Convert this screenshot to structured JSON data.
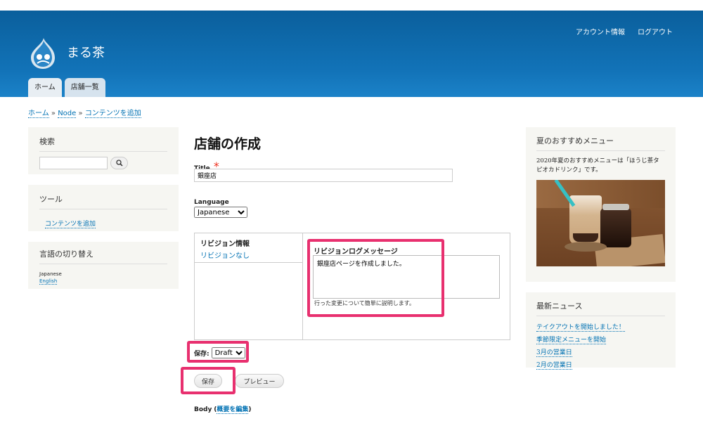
{
  "header": {
    "site_name": "まる茶",
    "secondary_menu": [
      "アカウント情報",
      "ログアウト"
    ],
    "tabs": [
      "ホーム",
      "店舗一覧"
    ]
  },
  "breadcrumb": {
    "items": [
      "ホーム",
      "Node",
      "コンテンツを追加"
    ],
    "separator": "»"
  },
  "left_sidebar": {
    "search": {
      "title": "検索",
      "value": ""
    },
    "tools": {
      "title": "ツール",
      "link": "コンテンツを追加"
    },
    "language": {
      "title": "言語の切り替え",
      "current": "Japanese",
      "other": "English"
    }
  },
  "main": {
    "title": "店舗の作成",
    "title_label": "Title",
    "required_mark": "*",
    "title_value": "銀座店",
    "language_label": "Language",
    "language_value": "Japanese",
    "revision": {
      "tab_title": "リビジョン情報",
      "tab_summary": "リビジョンなし",
      "log_label": "リビジョンログメッセージ",
      "log_value": "銀座店ページを作成しました。",
      "log_help": "行った変更について簡単に説明します。"
    },
    "save_state_label": "保存:",
    "save_state_value": "Draft",
    "save_button": "保存",
    "preview_button": "プレビュー",
    "body_label": "Body",
    "body_link": "概要を編集"
  },
  "right_sidebar": {
    "recommend": {
      "title": "夏のおすすめメニュー",
      "text": "2020年夏のおすすめメニューは「ほうじ茶タピオカドリンク」です。"
    },
    "news": {
      "title": "最新ニュース",
      "items": [
        "テイクアウトを開始しました！",
        "季節限定メニューを開始",
        "3月の営業日",
        "2月の営業日"
      ]
    }
  },
  "colors": {
    "header": "#1273b8",
    "link": "#0071b3",
    "highlight": "#e8306f",
    "sidebar_bg": "#f6f6f2"
  }
}
